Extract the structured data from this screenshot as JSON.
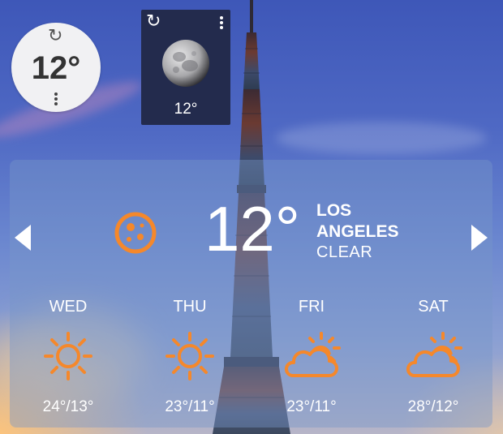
{
  "round_widget": {
    "temperature": "12°",
    "refresh_icon": "refresh-icon",
    "menu_icon": "vertical-dots-icon"
  },
  "moon_widget": {
    "temperature": "12°",
    "refresh_icon": "refresh-icon",
    "menu_icon": "vertical-dots-icon",
    "moon_icon": "moon-icon"
  },
  "current": {
    "temperature": "12°",
    "city_line1": "LOS",
    "city_line2": "ANGELES",
    "condition": "CLEAR",
    "icon": "moon-night-icon",
    "accent_color": "#f5882b"
  },
  "navigation": {
    "prev_icon": "chevron-left-icon",
    "next_icon": "chevron-right-icon"
  },
  "forecast": [
    {
      "day": "WED",
      "range": "24°/13°",
      "icon": "sun-icon"
    },
    {
      "day": "THU",
      "range": "23°/11°",
      "icon": "sun-icon"
    },
    {
      "day": "FRI",
      "range": "23°/11°",
      "icon": "partly-cloudy-icon"
    },
    {
      "day": "SAT",
      "range": "28°/12°",
      "icon": "partly-cloudy-icon"
    }
  ]
}
